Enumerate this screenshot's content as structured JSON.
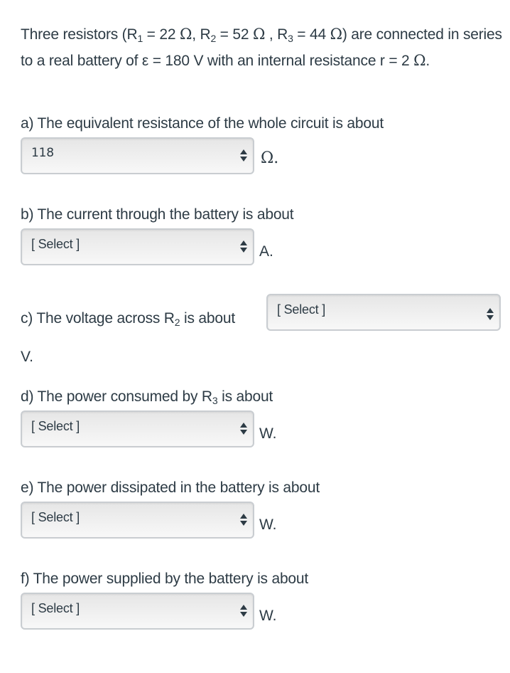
{
  "intro": {
    "p1": "Three resistors (R",
    "s1": "1",
    "p2": " = 22 ",
    "omega": "Ω",
    "p3": ", R",
    "s2": "2",
    "p4": " = 52 ",
    "p5": " , R",
    "s3": "3",
    "p6": " = 44 ",
    "p7": ") are connected in series to a real battery of ε = 180 V with an internal resistance r = 2 ",
    "p8": "."
  },
  "questions": {
    "a": {
      "text": "a) The equivalent resistance of the whole circuit is about",
      "selected": "118",
      "unit": "Ω."
    },
    "b": {
      "text": "b) The current through the battery is about",
      "selected": "[ Select ]",
      "unit": "A."
    },
    "c": {
      "text_pre": "c) The voltage across R",
      "sub": "2",
      "text_post": " is about",
      "selected": "[ Select ]",
      "unit": "V."
    },
    "d": {
      "text_pre": "d) The power consumed by R",
      "sub": "3",
      "text_post": " is about",
      "selected": "[ Select ]",
      "unit": "W."
    },
    "e": {
      "text": "e) The power dissipated in the battery is about",
      "selected": "[ Select ]",
      "unit": "W."
    },
    "f": {
      "text": "f) The power supplied by the battery is about",
      "selected": "[ Select ]",
      "unit": "W."
    }
  }
}
